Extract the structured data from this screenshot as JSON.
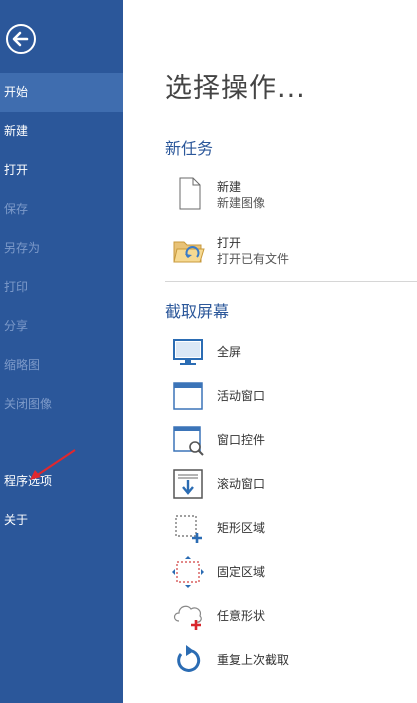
{
  "sidebar": {
    "items": [
      {
        "label": "开始",
        "state": "active"
      },
      {
        "label": "新建",
        "state": "normal"
      },
      {
        "label": "打开",
        "state": "normal"
      },
      {
        "label": "保存",
        "state": "disabled"
      },
      {
        "label": "另存为",
        "state": "disabled"
      },
      {
        "label": "打印",
        "state": "disabled"
      },
      {
        "label": "分享",
        "state": "disabled"
      },
      {
        "label": "缩略图",
        "state": "disabled"
      },
      {
        "label": "关闭图像",
        "state": "disabled"
      }
    ],
    "bottom_items": [
      {
        "label": "程序选项"
      },
      {
        "label": "关于"
      }
    ],
    "icons": {
      "back": "back-arrow-icon"
    }
  },
  "main": {
    "title": "选择操作...",
    "new_task": {
      "heading": "新任务",
      "items": [
        {
          "label": "新建",
          "desc": "新建图像",
          "icon": "new-file-icon"
        },
        {
          "label": "打开",
          "desc": "打开已有文件",
          "icon": "open-folder-icon"
        }
      ]
    },
    "capture": {
      "heading": "截取屏幕",
      "items": [
        {
          "label": "全屏",
          "icon": "monitor-icon"
        },
        {
          "label": "活动窗口",
          "icon": "window-icon"
        },
        {
          "label": "窗口控件",
          "icon": "window-control-icon"
        },
        {
          "label": "滚动窗口",
          "icon": "scroll-window-icon"
        },
        {
          "label": "矩形区域",
          "icon": "rectangle-region-icon"
        },
        {
          "label": "固定区域",
          "icon": "fixed-region-icon"
        },
        {
          "label": "任意形状",
          "icon": "freeform-shape-icon"
        },
        {
          "label": "重复上次截取",
          "icon": "repeat-icon"
        }
      ]
    }
  },
  "colors": {
    "sidebar_bg": "#2b579a",
    "sidebar_active": "#3f6daf",
    "sidebar_disabled_text": "#7d9ac9",
    "accent": "#2b579a",
    "annotation_arrow": "#e0282e"
  }
}
